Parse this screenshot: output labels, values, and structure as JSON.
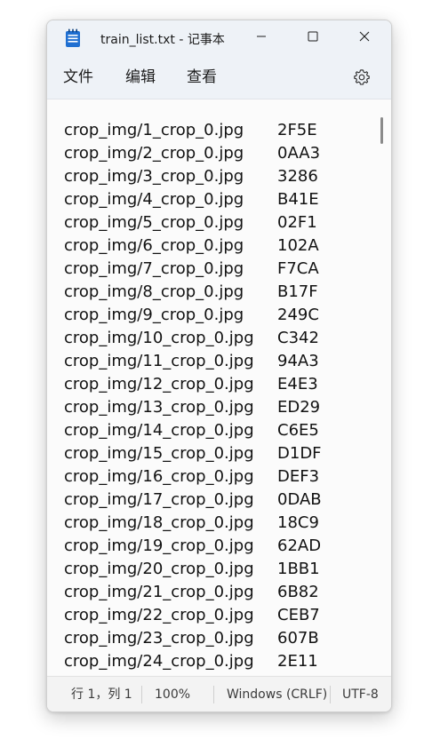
{
  "window": {
    "title": "train_list.txt - 记事本",
    "controls": {
      "minimize_icon": "minimize-icon",
      "maximize_icon": "maximize-icon",
      "close_icon": "close-icon"
    }
  },
  "menu": {
    "file": "文件",
    "edit": "编辑",
    "view": "查看",
    "settings_icon": "gear-icon"
  },
  "editor": {
    "lines": [
      {
        "file": "crop_img/1_crop_0.jpg",
        "code": "2F5E"
      },
      {
        "file": "crop_img/2_crop_0.jpg",
        "code": "0AA3"
      },
      {
        "file": "crop_img/3_crop_0.jpg",
        "code": "3286"
      },
      {
        "file": "crop_img/4_crop_0.jpg",
        "code": "B41E"
      },
      {
        "file": "crop_img/5_crop_0.jpg",
        "code": "02F1"
      },
      {
        "file": "crop_img/6_crop_0.jpg",
        "code": "102A"
      },
      {
        "file": "crop_img/7_crop_0.jpg",
        "code": "F7CA"
      },
      {
        "file": "crop_img/8_crop_0.jpg",
        "code": "B17F"
      },
      {
        "file": "crop_img/9_crop_0.jpg",
        "code": "249C"
      },
      {
        "file": "crop_img/10_crop_0.jpg",
        "code": "C342"
      },
      {
        "file": "crop_img/11_crop_0.jpg",
        "code": "94A3"
      },
      {
        "file": "crop_img/12_crop_0.jpg",
        "code": "E4E3"
      },
      {
        "file": "crop_img/13_crop_0.jpg",
        "code": "ED29"
      },
      {
        "file": "crop_img/14_crop_0.jpg",
        "code": "C6E5"
      },
      {
        "file": "crop_img/15_crop_0.jpg",
        "code": "D1DF"
      },
      {
        "file": "crop_img/16_crop_0.jpg",
        "code": "DEF3"
      },
      {
        "file": "crop_img/17_crop_0.jpg",
        "code": "0DAB"
      },
      {
        "file": "crop_img/18_crop_0.jpg",
        "code": "18C9"
      },
      {
        "file": "crop_img/19_crop_0.jpg",
        "code": "62AD"
      },
      {
        "file": "crop_img/20_crop_0.jpg",
        "code": "1BB1"
      },
      {
        "file": "crop_img/21_crop_0.jpg",
        "code": "6B82"
      },
      {
        "file": "crop_img/22_crop_0.jpg",
        "code": "CEB7"
      },
      {
        "file": "crop_img/23_crop_0.jpg",
        "code": "607B"
      },
      {
        "file": "crop_img/24_crop_0.jpg",
        "code": "2E11"
      }
    ]
  },
  "status": {
    "position": "行 1，列 1",
    "zoom": "100%",
    "line_ending": "Windows (CRLF)",
    "encoding": "UTF-8"
  },
  "colors": {
    "titlebar_bg": "#eef2f7",
    "editor_bg": "#fbfbfb",
    "app_icon_accent": "#1f6fd1"
  }
}
